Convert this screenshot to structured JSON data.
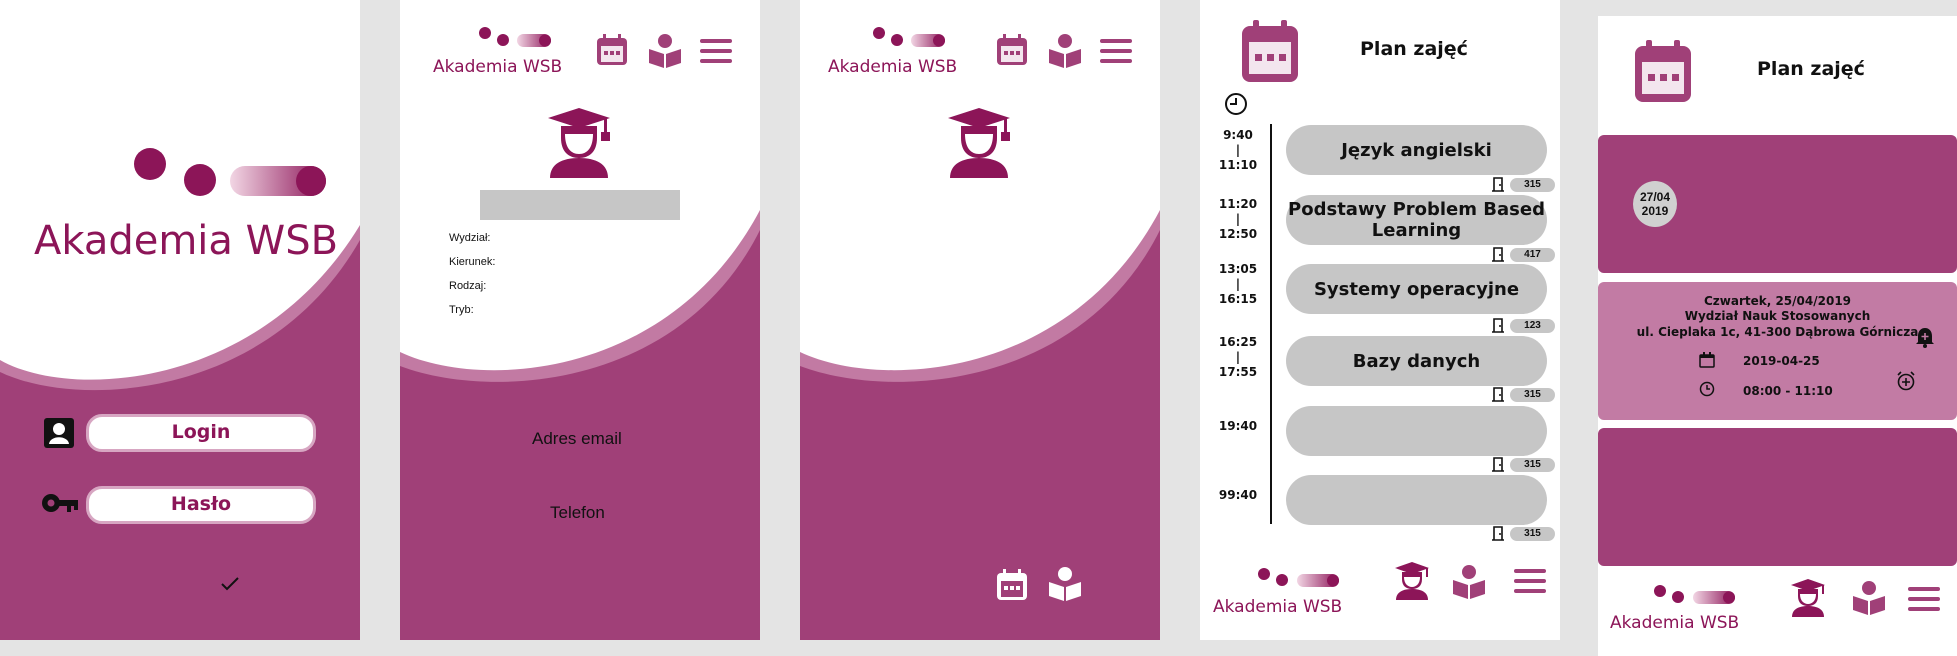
{
  "colors": {
    "brand": "#8c1558",
    "wave": "#a04078",
    "wave_light": "#c27aa3",
    "card_light": "#c27ba4",
    "slot_gray": "#c6c6c6"
  },
  "brand_name": "Akademia WSB",
  "login_screen": {
    "login_label": "Login",
    "password_label": "Hasło",
    "icons": [
      "user-icon",
      "key-icon",
      "check-icon"
    ]
  },
  "profile_screen": {
    "fields": [
      "Wydział:",
      "Kierunek:",
      "Rodzaj:",
      "Tryb:"
    ],
    "email_label": "Adres email",
    "phone_label": "Telefon"
  },
  "schedule_screen": {
    "title": "Plan zajęć",
    "slots": [
      {
        "start": "9:40",
        "end": "11:10",
        "subject": "Język angielski",
        "room": "315"
      },
      {
        "start": "11:20",
        "end": "12:50",
        "subject": "Podstawy Problem Based Learning",
        "room": "417"
      },
      {
        "start": "13:05",
        "end": "16:15",
        "subject": "Systemy operacyjne",
        "room": "123"
      },
      {
        "start": "16:25",
        "end": "17:55",
        "subject": "Bazy danych",
        "room": "315"
      },
      {
        "start": "19:40",
        "end": "",
        "subject": "",
        "room": "315"
      },
      {
        "start": "99:40",
        "end": "",
        "subject": "",
        "room": "315"
      }
    ]
  },
  "detail_screen": {
    "title": "Plan zajęć",
    "date_badge": "27/04\n2019",
    "day_line": "Czwartek, 25/04/2019",
    "faculty_line": "Wydział Nauk Stosowanych",
    "address_line": "ul. Cieplaka 1c, 41-300 Dąbrowa Górnicza",
    "date_value": "2019-04-25",
    "time_value": "08:00 - 11:10"
  }
}
